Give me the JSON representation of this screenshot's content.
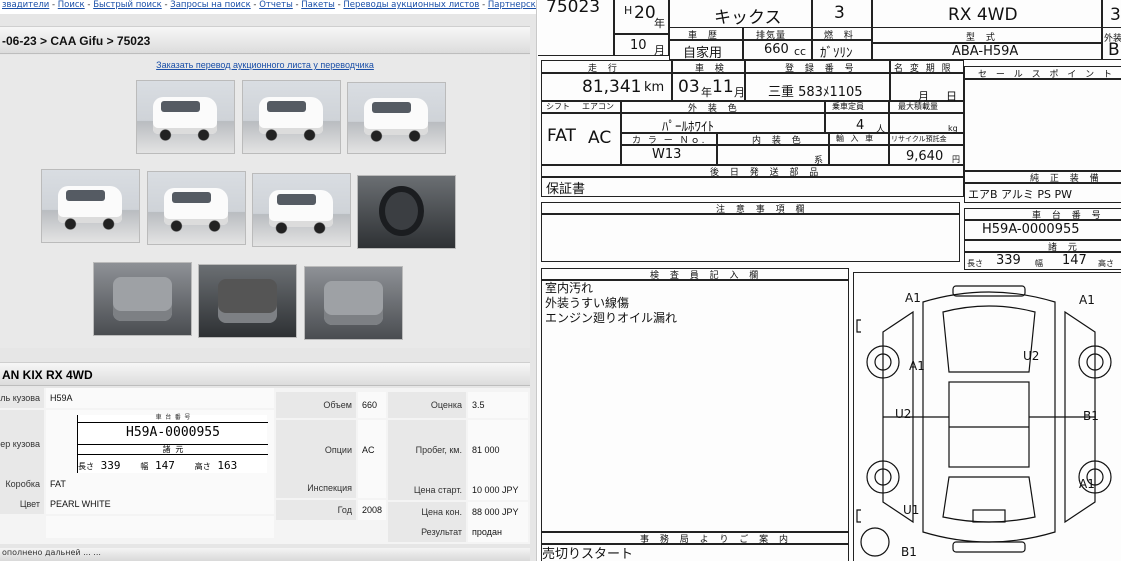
{
  "left_page": {
    "nav_links": [
      "звадители",
      "Поиск",
      "Быстрый поиск",
      "Запросы на поиск",
      "Отчеты",
      "Пакеты",
      "Переводы аукционных листов",
      "Партнерская прог"
    ],
    "breadcrumb": "-06-23 > CAA Gifu > 75023",
    "order_translation_link": "Заказать перевод аукционного листа у переводчика",
    "car_title": "AN KIX RX 4WD",
    "specs": {
      "body_model_label": "ль кузова",
      "body_model_value": "H59A",
      "body_number_label": "ер кузова",
      "mini_sheet": {
        "header": "車 台 番 号",
        "number": "H59A-0000955",
        "sub": "諸 元",
        "length_label": "長さ",
        "length": "339",
        "width_label": "幅",
        "width": "147",
        "height_label": "高さ",
        "height": "163"
      },
      "gearbox_label": "Коробка",
      "gearbox_value": "FAT",
      "color_label": "Цвет",
      "color_value": "PEARL WHITE",
      "volume_label": "Объем",
      "volume_value": "660",
      "options_label": "Опции",
      "options_value": "AC",
      "inspection_label": "Инспекция",
      "inspection_value": "",
      "year_label": "Год",
      "year_value": "2008",
      "grade_label": "Оценка",
      "grade_value": "3.5",
      "mileage_label": "Пробег, км.",
      "mileage_value": "81 000",
      "start_price_label": "Цена старт.",
      "start_price_value": "10 000 JPY",
      "end_price_label": "Цена кон.",
      "end_price_value": "88 000 JPY",
      "result_label": "Результат",
      "result_value": "продан"
    },
    "bottom_text": "ополнено   дальней   ...   ..."
  },
  "auction_sheet": {
    "lot_number": "75023",
    "era": "H",
    "year": "20",
    "year_unit": "年",
    "month": "10",
    "month_unit": "月",
    "model_name": "キックス",
    "grade_score": "3",
    "grade_name": "RX 4WD",
    "corner_number": "3",
    "ownership_label": "車 歴",
    "ownership": "自家用",
    "displacement_label": "排気量",
    "displacement": "660",
    "displacement_unit": "cc",
    "fuel_label": "燃 料",
    "fuel": "ｶﾞｿﾘﾝ",
    "type_label": "型 式",
    "type": "ABA-H59A",
    "outer_label": "外装",
    "outer_value": "B",
    "mileage_label": "走 行",
    "mileage": "81,341",
    "mileage_unit": "km",
    "inspection_label": "車 検",
    "inspection_year": "03",
    "inspection_year_unit": "年",
    "inspection_month": "11",
    "inspection_month_unit": "月",
    "registration_label": "登 録 番 号",
    "registration": "三重 583ﾒ1105",
    "name_change_label": "名 変 期 限",
    "name_change_month": "月",
    "name_change_day": "日",
    "sales_point_label": "セ ー ル ス ポ イ ン ト",
    "shift_label": "シフト",
    "shift": "FAT",
    "aircon_label": "エアコン",
    "aircon": "AC",
    "exterior_color_label": "外 装 色",
    "exterior_color": "ﾊﾟｰﾙﾎﾜｲﾄ",
    "capacity_label": "乗車定員",
    "capacity": "4",
    "capacity_unit": "人",
    "max_load_label": "最大積載量",
    "max_load_unit": "kg",
    "color_no_label": "カ ラ ー Ｎｏ.",
    "color_no": "W13",
    "interior_color_label": "内 装 色",
    "interior_color_unit": "系",
    "import_label": "輸 入 車",
    "recycle_label": "リサイクル預託金",
    "recycle_fee": "9,640",
    "recycle_unit": "円",
    "later_docs_label": "後 日 発 送 部 品",
    "later_docs": "保証書",
    "equipment_label": "純 正 装 備",
    "equipment": "エアB アルミ PS PW",
    "caution_label": "注 意 事 項 欄",
    "chassis_label": "車 台 番 号",
    "chassis": "H59A-0000955",
    "spec_label": "諸 元",
    "length_label": "長さ",
    "length": "339",
    "width_label": "幅",
    "width": "147",
    "height_label": "高さ",
    "inspector_label": "検 査 員 記 入 欄",
    "inspector_notes": [
      "室内汚れ",
      "外装うすい線傷",
      "エンジン廻りオイル漏れ"
    ],
    "office_label": "事 務 局 よ り ご 案 内",
    "office_note": "売切りスタート",
    "damage_codes": [
      "A1",
      "A1",
      "U2",
      "A1",
      "U2",
      "B1",
      "A1",
      "U1",
      "B1"
    ]
  }
}
